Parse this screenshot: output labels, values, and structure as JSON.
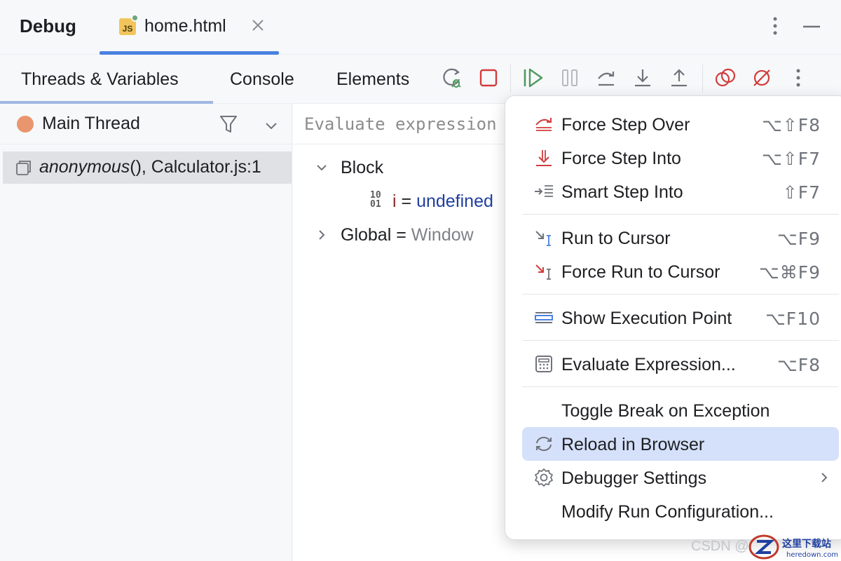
{
  "header": {
    "title": "Debug",
    "file_tab": {
      "badge": "JS",
      "label": "home.html"
    }
  },
  "tabs": [
    {
      "label": "Threads & Variables",
      "active": true
    },
    {
      "label": "Console",
      "active": false
    },
    {
      "label": "Elements",
      "active": false
    }
  ],
  "toolbar": {
    "icons": [
      "rerun-debug-icon",
      "stop-icon",
      "resume-icon",
      "pause-icon",
      "step-over-icon",
      "step-into-icon",
      "step-out-icon",
      "view-breakpoints-icon",
      "mute-breakpoints-icon",
      "more-icon"
    ]
  },
  "threads": {
    "selected": "Main Thread",
    "frame": {
      "function": "anonymous",
      "suffix": "(), Calculator.js:1"
    }
  },
  "evaluate": {
    "placeholder": "Evaluate expression"
  },
  "variables": [
    {
      "name": "Block",
      "expanded": true
    },
    {
      "name": "i",
      "eq": " = ",
      "value": "undefined",
      "badge_top": "10",
      "badge_bottom": "01"
    },
    {
      "name": "Global",
      "eq": " = ",
      "value": "Window",
      "expanded": false
    }
  ],
  "menu": {
    "items": [
      {
        "label": "Force Step Over",
        "shortcut": "⌥⇧F8",
        "icon": "force-step-over-icon"
      },
      {
        "label": "Force Step Into",
        "shortcut": "⌥⇧F7",
        "icon": "force-step-into-icon"
      },
      {
        "label": "Smart Step Into",
        "shortcut": "⇧F7",
        "icon": "smart-step-into-icon"
      },
      {
        "label": "Run to Cursor",
        "shortcut": "⌥F9",
        "icon": "run-to-cursor-icon"
      },
      {
        "label": "Force Run to Cursor",
        "shortcut": "⌥⌘F9",
        "icon": "force-run-to-cursor-icon"
      },
      {
        "label": "Show Execution Point",
        "shortcut": "⌥F10",
        "icon": "show-execution-point-icon"
      },
      {
        "label": "Evaluate Expression...",
        "shortcut": "⌥F8",
        "icon": "calculator-icon"
      },
      {
        "label": "Toggle Break on Exception",
        "shortcut": ""
      },
      {
        "label": "Reload in Browser",
        "shortcut": "",
        "icon": "reload-icon",
        "highlighted": true
      },
      {
        "label": "Debugger Settings",
        "shortcut": "",
        "icon": "gear-icon",
        "submenu": true
      },
      {
        "label": "Modify Run Configuration...",
        "shortcut": ""
      }
    ]
  },
  "watermark": {
    "text": "CSDN @",
    "logo_text": "这里下载站",
    "logo_url": "heredown.com"
  },
  "colors": {
    "accent": "#4a81e0",
    "highlight": "#d5e0fa",
    "thread_dot": "#e9966e",
    "value_blue": "#1f3fa0"
  }
}
